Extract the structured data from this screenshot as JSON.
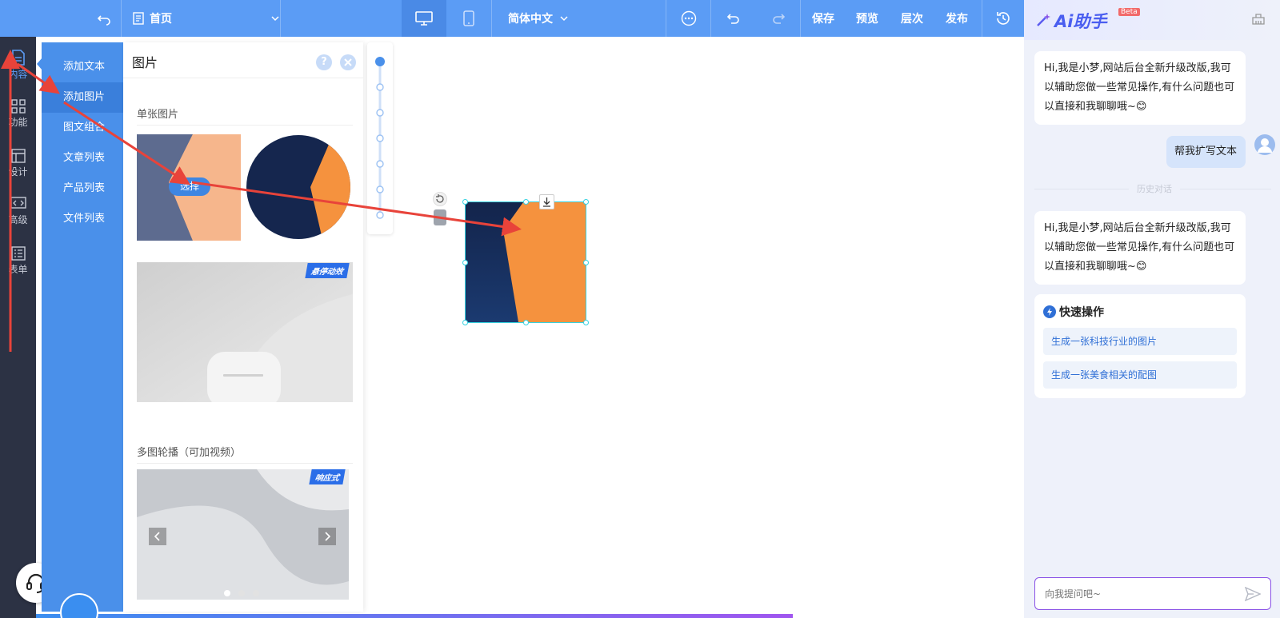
{
  "toolbar": {
    "page_label": "首页",
    "language_label": "简体中文",
    "save_label": "保存",
    "preview_label": "预览",
    "layers_label": "层次",
    "publish_label": "发布"
  },
  "left_rail": {
    "items": [
      {
        "label": "内容",
        "icon": "document-icon"
      },
      {
        "label": "功能",
        "icon": "grid-icon"
      },
      {
        "label": "设计",
        "icon": "layout-icon"
      },
      {
        "label": "高级",
        "icon": "code-icon"
      },
      {
        "label": "表单",
        "icon": "list-icon"
      }
    ]
  },
  "panel_nav": {
    "items": [
      "添加文本",
      "添加图片",
      "图文组合",
      "文章列表",
      "产品列表",
      "文件列表"
    ],
    "active_index": 1
  },
  "library": {
    "title": "图片",
    "single_section_label": "单张图片",
    "select_button_label": "选择",
    "hover_badge": "悬停动效",
    "carousel_section_label": "多图轮播（可加视频）",
    "responsive_badge": "响应式"
  },
  "ai_panel": {
    "title": "Ai助手",
    "beta_label": "Beta",
    "greeting_1": "Hi,我是小梦,网站后台全新升级改版,我可以辅助您做一些常见操作,有什么问题也可以直接和我聊聊哦~😊",
    "user_message": "帮我扩写文本",
    "history_divider": "历史对话",
    "greeting_2": "Hi,我是小梦,网站后台全新升级改版,我可以辅助您做一些常见操作,有什么问题也可以直接和我聊聊哦~😊",
    "quick_title": "快速操作",
    "quick_actions": [
      "生成一张科技行业的图片",
      "生成一张美食相关的配图"
    ],
    "input_placeholder": "向我提问吧~"
  },
  "colors": {
    "topbar": "#5b9cf5",
    "left_rail": "#2c3244",
    "panel_nav": "#4a90ea",
    "accent_orange": "#f5923e",
    "dark_navy": "#14254a",
    "annotation_red": "#e8433a"
  }
}
